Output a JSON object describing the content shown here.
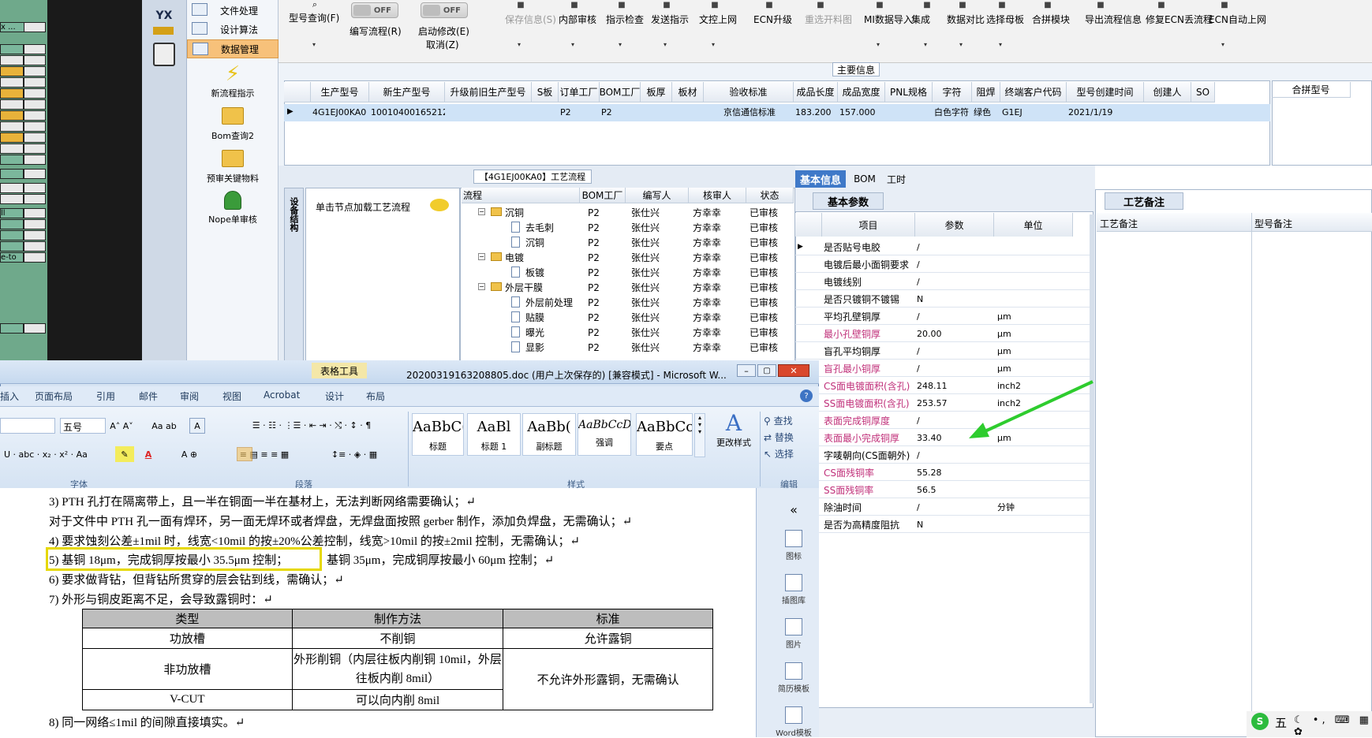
{
  "left_strip": {
    "cells": [
      "x ...",
      "",
      "",
      "",
      "",
      "",
      "",
      "",
      "",
      "",
      "",
      "",
      "",
      "",
      "",
      "ll",
      "",
      "",
      "",
      "e-to",
      ""
    ],
    "colors": {
      "green": "#7bb79c",
      "yellow": "#e8b23a"
    }
  },
  "nav": {
    "logo": "YX",
    "items": [
      {
        "label": "文件处理"
      },
      {
        "label": "设计算法"
      },
      {
        "label": "数据管理"
      }
    ],
    "big_buttons": [
      {
        "label": "新流程指示",
        "icon": "lightning-icon"
      },
      {
        "label": "Bom查询2",
        "icon": "folder-icon"
      },
      {
        "label": "预审关键物料",
        "icon": "folder-icon"
      },
      {
        "label": "Nope单审核",
        "icon": "user-icon"
      }
    ]
  },
  "toolbar": {
    "items": [
      {
        "label": "型号查询(F)",
        "arrow": "▾"
      },
      {
        "label": "OFF",
        "sub": "编写流程(R)"
      },
      {
        "label": "OFF",
        "sub": "启动修改(E)",
        "sub2": "取消(Z)"
      },
      {
        "label": "保存信息(S)",
        "arrow": "▾"
      },
      {
        "label": "内部审核",
        "arrow": "▾"
      },
      {
        "label": "指示检查",
        "arrow": "▾"
      },
      {
        "label": "发送指示",
        "arrow": "▾"
      },
      {
        "label": "文控上网",
        "arrow": "▾"
      },
      {
        "label": "ECN升级"
      },
      {
        "label": "重选开料图"
      },
      {
        "label": "MI数据导入",
        "arrow": "▾"
      },
      {
        "label": "集成",
        "arrow": "▾"
      },
      {
        "label": "数据对比",
        "arrow": "▾"
      },
      {
        "label": "选择母板",
        "arrow": "▾"
      },
      {
        "label": "合拼模块"
      },
      {
        "label": "导出流程信息"
      },
      {
        "label": "修复ECN丢流程"
      },
      {
        "label": "ECN自动上网",
        "arrow": "▾"
      }
    ]
  },
  "main_info": {
    "title": "主要信息",
    "headers": [
      "生产型号",
      "新生产型号",
      "升级前旧生产型号",
      "S板",
      "订单工厂",
      "BOM工厂",
      "板厚",
      "板材",
      "验收标准",
      "成品长度",
      "成品宽度",
      "PNL规格",
      "字符",
      "阻焊",
      "终端客户代码",
      "型号创建时间",
      "创建人",
      "SO"
    ],
    "row": [
      "4G1EJ00KA0",
      "10010400165212",
      "",
      "",
      "P2",
      "P2",
      "",
      "",
      "京信通信标准",
      "183.200",
      "157.000",
      "",
      "白色字符",
      "绿色",
      "G1EJ",
      "2021/1/19",
      "",
      ""
    ],
    "merge_header": "合拼型号"
  },
  "process": {
    "title": "【4G1EJ00KA0】工艺流程",
    "side_tab": "设备结构",
    "node_hint": "单击节点加载工艺流程",
    "headers": [
      "流程",
      "BOM工厂",
      "编写人",
      "核审人",
      "状态"
    ],
    "rows": [
      {
        "name": "沉铜",
        "level": 0,
        "folder": true,
        "bom": "P2",
        "writer": "张仕兴",
        "checker": "方幸幸",
        "status": "已审核"
      },
      {
        "name": "去毛刺",
        "level": 1,
        "bom": "P2",
        "writer": "张仕兴",
        "checker": "方幸幸",
        "status": "已审核"
      },
      {
        "name": "沉铜",
        "level": 1,
        "bom": "P2",
        "writer": "张仕兴",
        "checker": "方幸幸",
        "status": "已审核"
      },
      {
        "name": "电镀",
        "level": 0,
        "folder": true,
        "bom": "P2",
        "writer": "张仕兴",
        "checker": "方幸幸",
        "status": "已审核"
      },
      {
        "name": "板镀",
        "level": 1,
        "bom": "P2",
        "writer": "张仕兴",
        "checker": "方幸幸",
        "status": "已审核"
      },
      {
        "name": "外层干膜",
        "level": 0,
        "folder": true,
        "bom": "P2",
        "writer": "张仕兴",
        "checker": "方幸幸",
        "status": "已审核"
      },
      {
        "name": "外层前处理",
        "level": 1,
        "bom": "P2",
        "writer": "张仕兴",
        "checker": "方幸幸",
        "status": "已审核"
      },
      {
        "name": "贴膜",
        "level": 1,
        "bom": "P2",
        "writer": "张仕兴",
        "checker": "方幸幸",
        "status": "已审核"
      },
      {
        "name": "曝光",
        "level": 1,
        "bom": "P2",
        "writer": "张仕兴",
        "checker": "方幸幸",
        "status": "已审核"
      },
      {
        "name": "显影",
        "level": 1,
        "bom": "P2",
        "writer": "张仕兴",
        "checker": "方幸幸",
        "status": "已审核"
      }
    ]
  },
  "info_tabs": [
    "基本信息",
    "BOM",
    "工时"
  ],
  "params": {
    "tab": "基本参数",
    "headers": [
      "项目",
      "参数",
      "单位"
    ],
    "rows": [
      {
        "item": "是否贴号电胶",
        "value": "/",
        "unit": "",
        "pink": false
      },
      {
        "item": "电镀后最小面铜要求",
        "value": "/",
        "unit": "",
        "pink": false
      },
      {
        "item": "电镀线别",
        "value": "/",
        "unit": "",
        "pink": false
      },
      {
        "item": "是否只镀铜不镀锡",
        "value": "N",
        "unit": "",
        "pink": false
      },
      {
        "item": "平均孔壁铜厚",
        "value": "/",
        "unit": "μm",
        "pink": false
      },
      {
        "item": "最小孔壁铜厚",
        "value": "20.00",
        "unit": "μm",
        "pink": true
      },
      {
        "item": "盲孔平均铜厚",
        "value": "/",
        "unit": "μm",
        "pink": false
      },
      {
        "item": "盲孔最小铜厚",
        "value": "/",
        "unit": "μm",
        "pink": true
      },
      {
        "item": "CS面电镀面积(含孔)",
        "value": "248.11",
        "unit": "inch2",
        "pink": true
      },
      {
        "item": "SS面电镀面积(含孔)",
        "value": "253.57",
        "unit": "inch2",
        "pink": true
      },
      {
        "item": "表面完成铜厚度",
        "value": "/",
        "unit": "",
        "pink": true
      },
      {
        "item": "表面最小完成铜厚",
        "value": "33.40",
        "unit": "μm",
        "pink": true
      },
      {
        "item": "字唛朝向(CS面朝外)",
        "value": "/",
        "unit": "",
        "pink": false
      },
      {
        "item": "CS面残铜率",
        "value": "55.28",
        "unit": "",
        "pink": true
      },
      {
        "item": "SS面残铜率",
        "value": "56.5",
        "unit": "",
        "pink": true
      },
      {
        "item": "除油时间",
        "value": "/",
        "unit": "分钟",
        "pink": false
      },
      {
        "item": "是否为高精度阻抗",
        "value": "N",
        "unit": "",
        "pink": false
      }
    ]
  },
  "remarks": {
    "tab": "工艺备注",
    "col1": "工艺备注",
    "col2": "型号备注"
  },
  "word": {
    "tools_label": "表格工具",
    "title": "20200319163208805.doc (用户上次保存的) [兼容模式] - Microsoft W...",
    "tabs": [
      "插入",
      "页面布局",
      "引用",
      "邮件",
      "审阅",
      "视图",
      "Acrobat",
      "设计",
      "布局"
    ],
    "font_size": "五号",
    "styles": [
      {
        "preview": "AaBbC(",
        "name": "标题"
      },
      {
        "preview": "AaBl",
        "name": "标题 1"
      },
      {
        "preview": "AaBb(",
        "name": "副标题"
      },
      {
        "preview": "AaBbCcD",
        "name": "强调"
      },
      {
        "preview": "AaBbCcD",
        "name": "要点"
      }
    ],
    "change_styles": "更改样式",
    "edit": {
      "find": "查找",
      "replace": "替换",
      "select": "选择"
    },
    "groups": {
      "font": "字体",
      "paragraph": "段落",
      "styles": "样式",
      "edit": "编辑"
    },
    "doc_lines": [
      "3) PTH 孔打在隔离带上，且一半在铜面一半在基材上，无法判断网络需要确认；↵",
      "对于文件中 PTH 孔一面有焊环，另一面无焊环或者焊盘，无焊盘面按照 gerber 制作，添加负焊盘，无需确认；↵",
      "4) 要求蚀刻公差±1mil 时，线宽<10mil 的按±20%公差控制，线宽>10mil 的按±2mil 控制，无需确认；↵",
      "5) 基铜 18μm，完成铜厚按最小 35.5μm 控制；",
      "基铜 35μm，完成铜厚按最小 60μm 控制；↵",
      "6) 要求做背钻，但背钻所贯穿的层会钻到线，需确认；↵",
      "7) 外形与铜皮距离不足，会导致露铜时：↵",
      "8) 同一网络≤1mil 的间隙直接填实。↵"
    ],
    "table": {
      "headers": [
        "类型",
        "制作方法",
        "标准"
      ],
      "rows": [
        [
          "功放槽",
          "不削铜",
          "允许露铜"
        ],
        [
          "非功放槽",
          "外形削铜（内层往板内削铜 10mil，外层往板内削 8mil）",
          "不允许外形露铜，无需确认"
        ],
        [
          "V-CUT",
          "可以向内削 8mil",
          ""
        ]
      ]
    },
    "side_buttons": [
      "图标",
      "插图库",
      "图片",
      "简历模板",
      "Word模板"
    ]
  },
  "tray": {
    "ime": "五"
  },
  "colors": {
    "arrow": "#2ecc2e",
    "highlight_box": "#e6d800",
    "selected_nav": "#f7c17a"
  }
}
